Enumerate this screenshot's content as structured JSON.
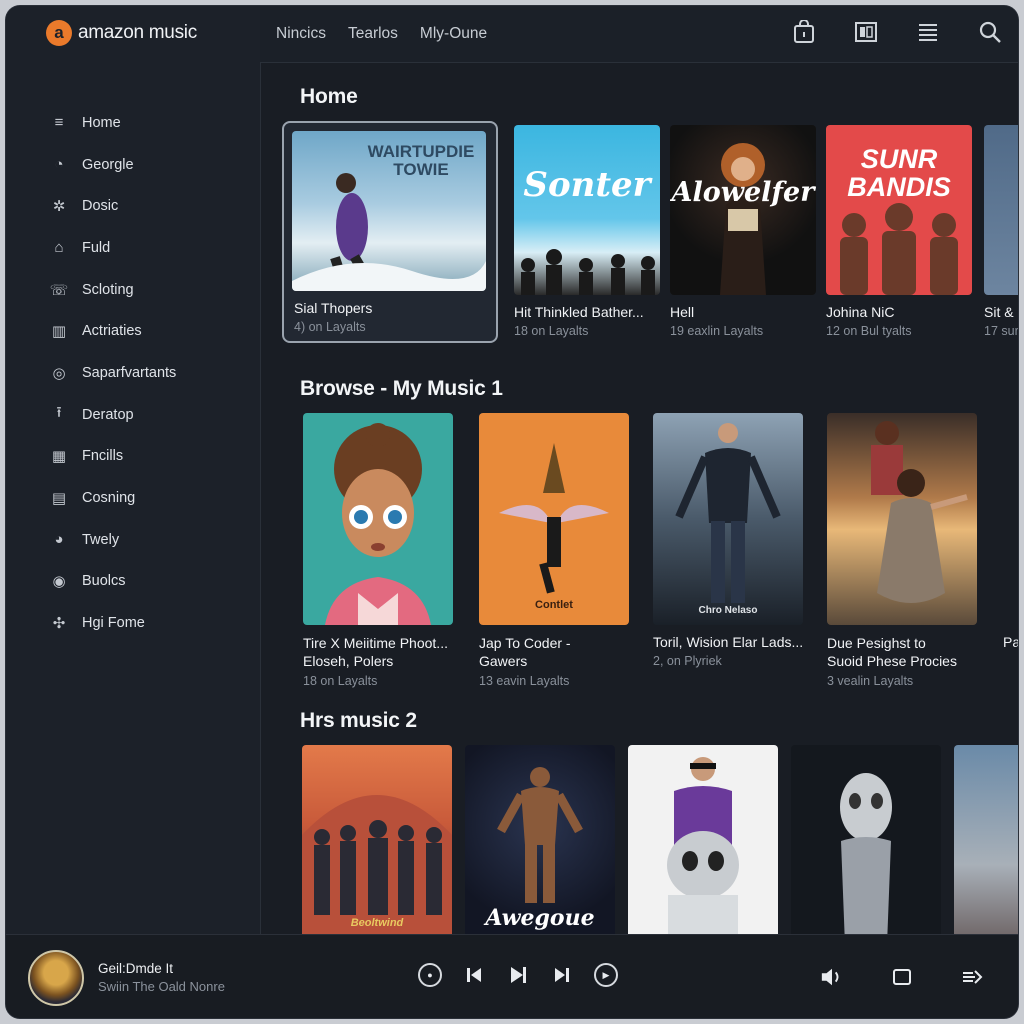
{
  "app": {
    "brand": "amazon music",
    "brand_mark": "a"
  },
  "header": {
    "tabs": [
      "Nincics",
      "Tearlos",
      "Mly-Oune"
    ],
    "icons": [
      "bag-icon",
      "library-icon",
      "queue-icon",
      "search-icon"
    ]
  },
  "sidebar": {
    "items": [
      {
        "label": "Home",
        "icon": "menu-icon",
        "glyph": "≡"
      },
      {
        "label": "Georgle",
        "icon": "clock-icon",
        "glyph": "◔"
      },
      {
        "label": "Dosic",
        "icon": "settings-icon",
        "glyph": "✲"
      },
      {
        "label": "Fuld",
        "icon": "home-icon",
        "glyph": "⌂"
      },
      {
        "label": "Scloting",
        "icon": "phone-icon",
        "glyph": "☏"
      },
      {
        "label": "Actriaties",
        "icon": "chart-icon",
        "glyph": "▥"
      },
      {
        "label": "Saparfvartants",
        "icon": "target-icon",
        "glyph": "◎"
      },
      {
        "label": "Deratop",
        "icon": "upload-icon",
        "glyph": "⭱"
      },
      {
        "label": "Fncills",
        "icon": "bars-icon",
        "glyph": "▦"
      },
      {
        "label": "Cosning",
        "icon": "calendar-icon",
        "glyph": "▤"
      },
      {
        "label": "Twely",
        "icon": "cloud-icon",
        "glyph": "◕"
      },
      {
        "label": "Buolcs",
        "icon": "disc-icon",
        "glyph": "◉"
      },
      {
        "label": "Hgi Fome",
        "icon": "puzzle-icon",
        "glyph": "✣"
      }
    ]
  },
  "sections": [
    {
      "title": "Home",
      "cards": [
        {
          "title": "Sial Thopers",
          "sub": "4) on Layalts",
          "art_text": "WAIRTUPDIE TOWIE"
        },
        {
          "title": "Hit Thinkled Bather...",
          "sub": "18 on Layalts",
          "art_text": "Sonter"
        },
        {
          "title": "Hell",
          "sub": "19 eaxlin Layalts",
          "art_text": "Alowelfer"
        },
        {
          "title": "Johina NiC",
          "sub": "12 on Bul tyalts",
          "art_text": "SUNR BANDIS"
        },
        {
          "title": "Sit &",
          "sub": "17 sur"
        }
      ]
    },
    {
      "title": "Browse - My Music 1",
      "cards": [
        {
          "title": "Tire X Meiitime Phoot...",
          "title2": "Eloseh, Polers",
          "sub": "18 on Layalts"
        },
        {
          "title": "Jap To Coder -",
          "title2": "Gawers",
          "sub": "13 eavin Layalts",
          "art_text": "Contlet"
        },
        {
          "title": "Toril, Wision Elar Lads...",
          "sub": "2, on Plyriek",
          "art_text": "Chro Nelaso"
        },
        {
          "title": "Due Pesighst to",
          "title2": "Suoid Phese Procies",
          "sub": "3 vealin Layalts"
        },
        {
          "title": "Pa"
        }
      ]
    },
    {
      "title": "Hrs music 2",
      "cards": [
        {
          "art_text": "Beoltwind"
        },
        {
          "art_text": "Awegoue"
        },
        {},
        {},
        {}
      ]
    }
  ],
  "player": {
    "title": "Geil:Dmde It",
    "artist": "Swiin The Oald Nonre",
    "controls": [
      "prev-circle",
      "skip-back",
      "play",
      "skip-forward",
      "next-circle"
    ],
    "right_controls": [
      "volume-icon",
      "miniplayer-icon",
      "queue-arrow-icon"
    ]
  },
  "colors": {
    "accent": "#ea7a2b",
    "background": "#191d24",
    "sidebar": "#1c2129"
  }
}
